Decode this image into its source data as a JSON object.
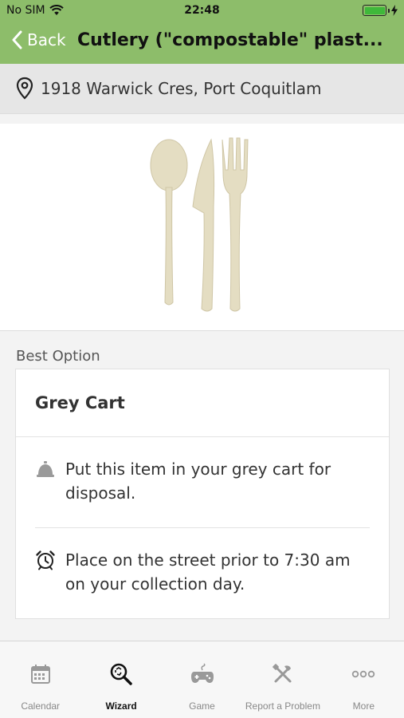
{
  "status_bar": {
    "carrier": "No SIM",
    "time": "22:48",
    "battery_level": 1.0,
    "battery_color": "#3fb83a"
  },
  "nav": {
    "back_label": "Back",
    "title": "Cutlery (\"compostable\" plast..."
  },
  "address": {
    "text": "1918 Warwick Cres, Port Coquitlam",
    "icon": "location-pin-icon"
  },
  "item_image": {
    "icon": "cutlery-image"
  },
  "best_option": {
    "section_label": "Best Option",
    "title": "Grey Cart",
    "rows": [
      {
        "icon": "bell-icon",
        "text": "Put this item in your grey cart for disposal."
      },
      {
        "icon": "alarm-clock-icon",
        "text": "Place on the street prior to 7:30 am on your collection day."
      }
    ]
  },
  "tabs": [
    {
      "label": "Calendar",
      "icon": "calendar-icon",
      "active": false
    },
    {
      "label": "Wizard",
      "icon": "wizard-search-icon",
      "active": true
    },
    {
      "label": "Game",
      "icon": "gamepad-icon",
      "active": false
    },
    {
      "label": "Report a Problem",
      "icon": "tools-icon",
      "active": false
    },
    {
      "label": "More",
      "icon": "more-dots-icon",
      "active": false
    }
  ],
  "colors": {
    "header_green": "#8dbd6a",
    "address_bg": "#e6e6e6"
  }
}
